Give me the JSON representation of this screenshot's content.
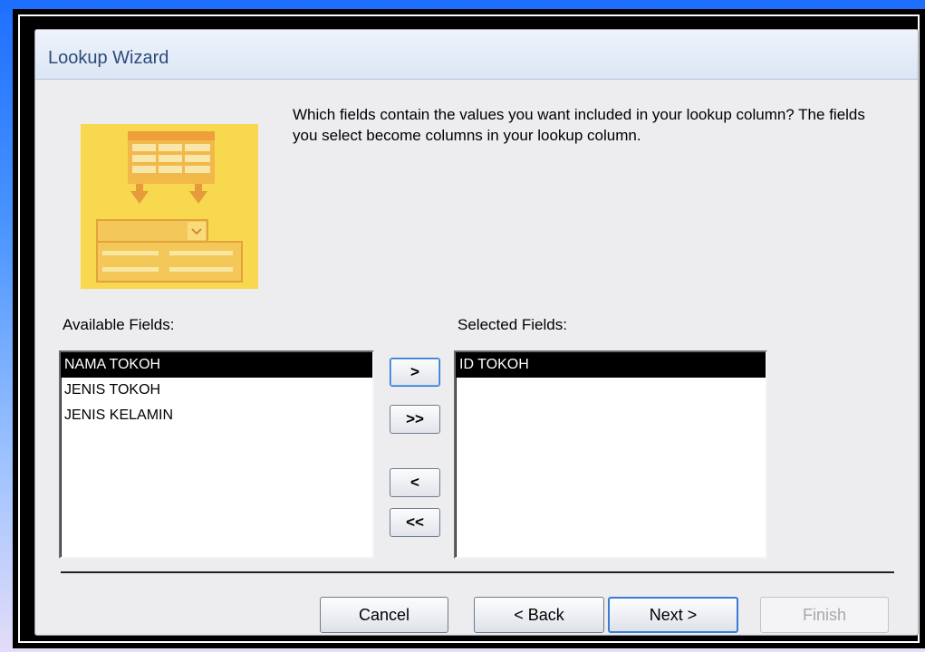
{
  "dialog": {
    "title": "Lookup Wizard",
    "question": "Which fields contain the values you want included in your lookup column? The fields you select become columns in your lookup column."
  },
  "available": {
    "label": "Available Fields:",
    "items": [
      "NAMA TOKOH",
      "JENIS TOKOH",
      "JENIS KELAMIN"
    ],
    "selected_value": "NAMA TOKOH"
  },
  "selected": {
    "label": "Selected Fields:",
    "items": [
      "ID TOKOH"
    ],
    "selected_value": "ID TOKOH"
  },
  "move_buttons": {
    "add_one": ">",
    "add_all": ">>",
    "remove_one": "<",
    "remove_all": "<<"
  },
  "footer": {
    "cancel": "Cancel",
    "back": "< Back",
    "next": "Next >",
    "finish": "Finish"
  },
  "colors": {
    "illustration": "#f8d84e",
    "default_button_border": "#3a7bd5",
    "selection": "#000000"
  },
  "icons": {
    "illustration": "lookup-wizard-illustration-icon"
  }
}
